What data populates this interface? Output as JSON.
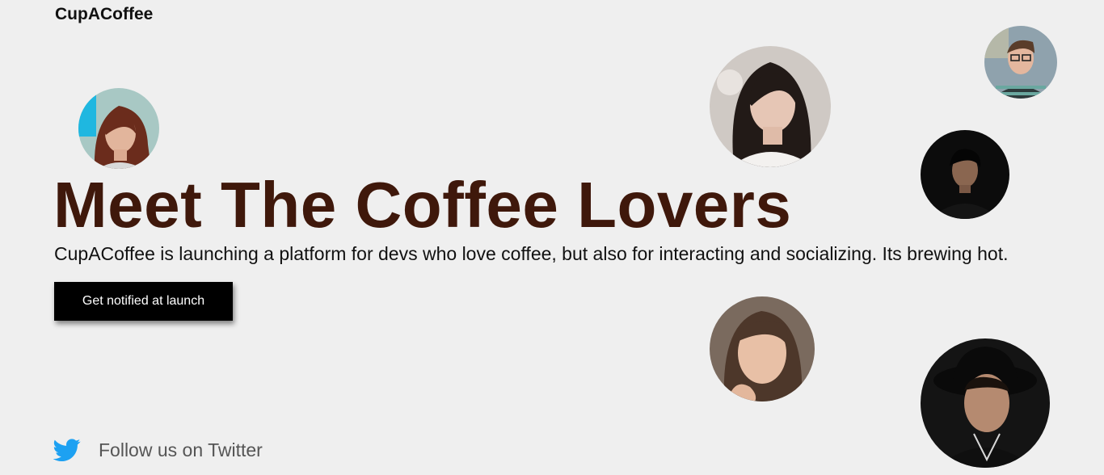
{
  "brand": "CupACoffee",
  "hero": {
    "title": "Meet The Coffee Lovers",
    "subtitle": "CupACoffee is launching a platform for devs who love coffee, but also for interacting and socializing. Its brewing hot.",
    "cta_label": "Get notified at launch"
  },
  "social": {
    "twitter_label": "Follow us on Twitter",
    "icon": "twitter-bird-icon"
  },
  "colors": {
    "background": "#efefef",
    "headline": "#3f180b",
    "cta_bg": "#000000",
    "twitter_blue": "#1da1f2"
  },
  "avatars": [
    {
      "name": "avatar-woman-red-hair"
    },
    {
      "name": "avatar-woman-dark-hair"
    },
    {
      "name": "avatar-man-glasses"
    },
    {
      "name": "avatar-man-black-shirt"
    },
    {
      "name": "avatar-woman-freckles"
    },
    {
      "name": "avatar-man-hat"
    }
  ]
}
